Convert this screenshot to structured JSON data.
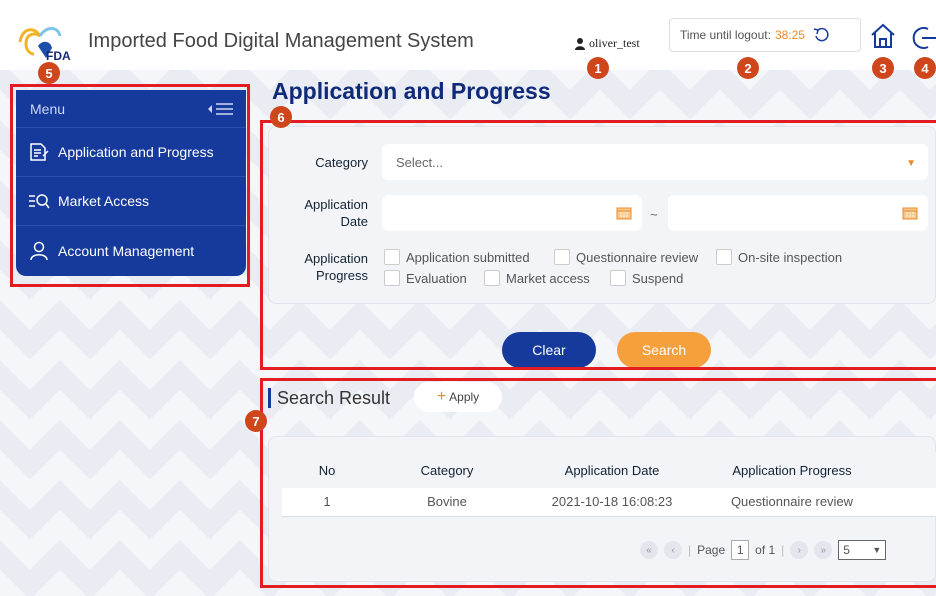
{
  "header": {
    "logo_text": "FDA",
    "title": "Imported Food Digital Management System",
    "username": "oliver_test",
    "logout_label": "Time until logout:",
    "logout_time": "38:25"
  },
  "markers": [
    "1",
    "2",
    "3",
    "4",
    "5",
    "6",
    "7"
  ],
  "sidebar": {
    "menu_label": "Menu",
    "items": [
      {
        "label": "Application and Progress",
        "icon": "document-list-icon"
      },
      {
        "label": "Market Access",
        "icon": "list-search-icon"
      },
      {
        "label": "Account Management",
        "icon": "user-icon"
      }
    ]
  },
  "main": {
    "page_title": "Application and Progress",
    "filter": {
      "category_label": "Category",
      "category_placeholder": "Select...",
      "date_label": "Application Date",
      "date_separator": "~",
      "progress_label": "Application Progress",
      "progress_options": [
        "Application submitted",
        "Questionnaire review",
        "On-site inspection",
        "Evaluation",
        "Market access",
        "Suspend"
      ],
      "clear_label": "Clear",
      "search_label": "Search"
    },
    "results": {
      "title": "Search Result",
      "apply_label": "Apply",
      "columns": [
        "No",
        "Category",
        "Application Date",
        "Application Progress"
      ],
      "rows": [
        [
          "1",
          "Bovine",
          "2021-10-18 16:08:23",
          "Questionnaire review"
        ]
      ],
      "pager": {
        "page_label": "Page",
        "current_page": "1",
        "of_label": "of 1",
        "page_size": "5"
      }
    }
  },
  "colors": {
    "primary": "#163a9c",
    "accent": "#f5a03c",
    "marker": "#d0461c",
    "highlight_box": "#e31c23"
  }
}
